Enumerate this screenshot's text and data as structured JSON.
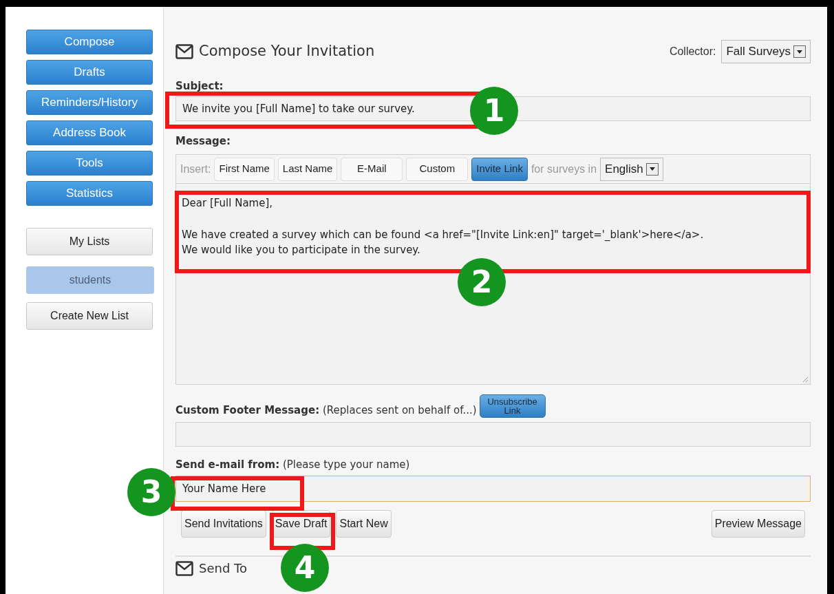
{
  "sidebar": {
    "nav": [
      {
        "label": "Compose"
      },
      {
        "label": "Drafts"
      },
      {
        "label": "Reminders/History"
      },
      {
        "label": "Address Book"
      },
      {
        "label": "Tools"
      },
      {
        "label": "Statistics"
      }
    ],
    "lists_button": "My Lists",
    "lists": [
      {
        "label": "students",
        "selected": true
      }
    ],
    "create_button": "Create New List"
  },
  "compose": {
    "title": "Compose Your Invitation",
    "collector_label": "Collector:",
    "collector_value": "Fall Surveys",
    "subject_label": "Subject:",
    "subject_value": "We invite you [Full Name] to take our survey.",
    "message_label": "Message:",
    "insert_label": "Insert:",
    "insert_buttons": [
      {
        "label": "First Name",
        "highlighted": false
      },
      {
        "label": "Last Name",
        "highlighted": false
      },
      {
        "label": "E-Mail",
        "highlighted": false
      },
      {
        "label": "Custom",
        "highlighted": false
      },
      {
        "label": "Invite Link",
        "highlighted": true
      }
    ],
    "language_label": "for surveys in",
    "language_value": "English",
    "message_greeting": "Dear [Full Name],",
    "message_lines": [
      "We have created a survey which can be found <a href=\"[Invite Link:en]\" target='_blank'>here</a>.",
      "We would like you to participate in the survey."
    ],
    "footer_label": "Custom Footer Message:",
    "footer_hint": "(Replaces sent on behalf of...)",
    "unsubscribe_button": "Unsubscribe Link",
    "from_label": "Send e-mail from:",
    "from_hint": "(Please type your name)",
    "from_value": "Your Name Here",
    "buttons": [
      "Send Invitations",
      "Save Draft",
      "Start New"
    ],
    "preview_button": "Preview Message"
  },
  "send_to": {
    "title": "Send To"
  },
  "annotations": [
    {
      "number": "1"
    },
    {
      "number": "2"
    },
    {
      "number": "3"
    },
    {
      "number": "4"
    }
  ]
}
